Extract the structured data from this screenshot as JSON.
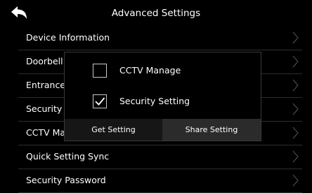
{
  "header": {
    "title": "Advanced Settings"
  },
  "menu": [
    {
      "label": "Device Information"
    },
    {
      "label": "Doorbell"
    },
    {
      "label": "Entrance"
    },
    {
      "label": "Security"
    },
    {
      "label": "CCTV Ma"
    },
    {
      "label": "Quick Setting Sync"
    },
    {
      "label": "Security Password"
    }
  ],
  "popup": {
    "options": [
      {
        "label": "CCTV Manage",
        "checked": false
      },
      {
        "label": "Security Setting",
        "checked": true
      }
    ],
    "get_label": "Get Setting",
    "share_label": "Share Setting"
  }
}
